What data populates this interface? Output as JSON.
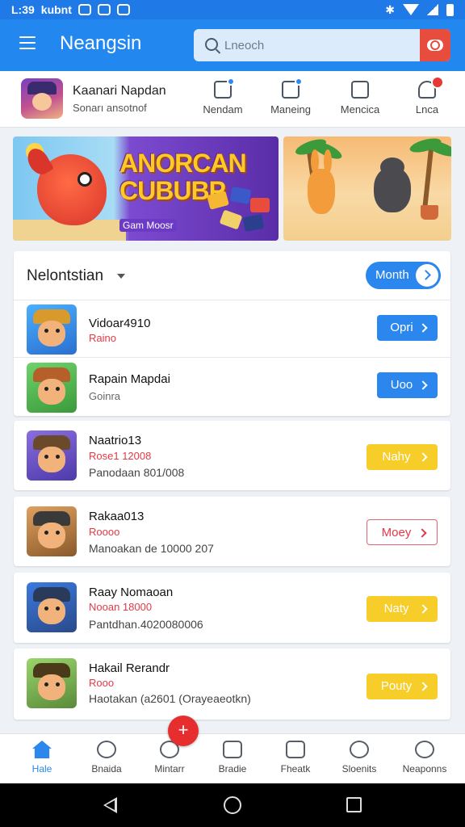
{
  "status_bar": {
    "time": "L:39",
    "carrier": "kubnt"
  },
  "app_bar": {
    "title": "Neangsin",
    "search_placeholder": "Lneoch"
  },
  "profile": {
    "name": "Kaanari Napdan",
    "subtitle": "Sonarı ansotnof",
    "actions": [
      {
        "label": "Nendam",
        "icon": "wallet-icon",
        "badge": true
      },
      {
        "label": "Maneing",
        "icon": "messages-icon",
        "badge": true
      },
      {
        "label": "Mencica",
        "icon": "document-icon",
        "badge": false
      },
      {
        "label": "Lnca",
        "icon": "person-icon",
        "badge": true,
        "badge_color": "#e53935"
      }
    ]
  },
  "banners": [
    {
      "headline": "ANORCAN CUBUBP",
      "tag": "Gam Moosr"
    },
    {
      "headline": ""
    }
  ],
  "leaderboard": {
    "title": "Nelontstian",
    "filter_button": "Month"
  },
  "items": [
    {
      "name": "Vidoar4910",
      "sub": "Raino",
      "detail": "",
      "action": "Opri",
      "style": "blue"
    },
    {
      "name": "Rapain Mapdai",
      "sub": "Goinra",
      "detail": "",
      "action": "Uoo",
      "style": "blue"
    },
    {
      "name": "Naatrio13",
      "sub": "Rose1 12008",
      "detail": "Panodaan 801/008",
      "action": "Nahy",
      "style": "yellow"
    },
    {
      "name": "Rakaa013",
      "sub": "Roooo",
      "detail": "Manoakan de 10000 207",
      "action": "Moey",
      "style": "outline"
    },
    {
      "name": "Raay Nomaoan",
      "sub": "Nooan 18000",
      "detail": "Pantdhan.4020080006",
      "action": "Naty",
      "style": "yellow"
    },
    {
      "name": "Hakail Rerandr",
      "sub": "Rooo",
      "detail": "Haotakan (a2601 (Orayeaeotkn)",
      "action": "Pouty",
      "style": "yellow"
    }
  ],
  "fab": {
    "label": "+"
  },
  "bottom_nav": [
    {
      "label": "Hale",
      "icon": "home-icon",
      "active": true
    },
    {
      "label": "Bnaida",
      "icon": "chat-icon",
      "active": false
    },
    {
      "label": "Mintarr",
      "icon": "dashboard-icon",
      "active": false
    },
    {
      "label": "Bradie",
      "icon": "image-icon",
      "active": false
    },
    {
      "label": "Fheatk",
      "icon": "list-icon",
      "active": false
    },
    {
      "label": "Sloenits",
      "icon": "group-icon",
      "active": false
    },
    {
      "label": "Neaponns",
      "icon": "profile-icon",
      "active": false
    }
  ],
  "colors": {
    "primary": "#2387f0",
    "accent_red": "#e53946",
    "action_yellow": "#f7cd2a"
  }
}
